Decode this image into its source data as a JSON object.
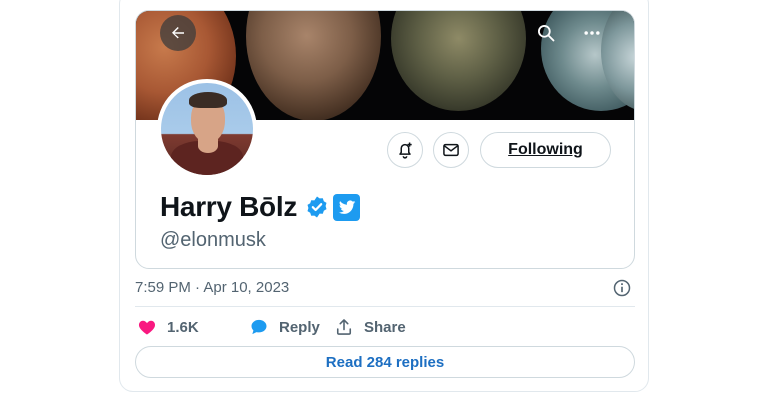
{
  "profile": {
    "display_name": "Harry Bōlz",
    "handle": "@elonmusk",
    "following_label": "Following"
  },
  "tweet": {
    "timestamp": "7:59 PM · Apr 10, 2023",
    "likes": "1.6K",
    "reply_label": "Reply",
    "share_label": "Share",
    "read_replies_label": "Read 284 replies"
  },
  "icons": {
    "back": "back-arrow-icon",
    "search": "search-icon",
    "more": "more-dots-icon",
    "notify": "bell-plus-icon",
    "message": "envelope-icon",
    "verified": "verified-check-icon",
    "twitter": "twitter-bird-icon",
    "info": "info-icon",
    "like": "heart-icon",
    "reply": "speech-bubble-icon",
    "share": "share-upload-icon"
  },
  "colors": {
    "accent": "#1d9bf0",
    "like": "#f91880",
    "text_secondary": "#536471",
    "link": "#1d6fc2"
  }
}
